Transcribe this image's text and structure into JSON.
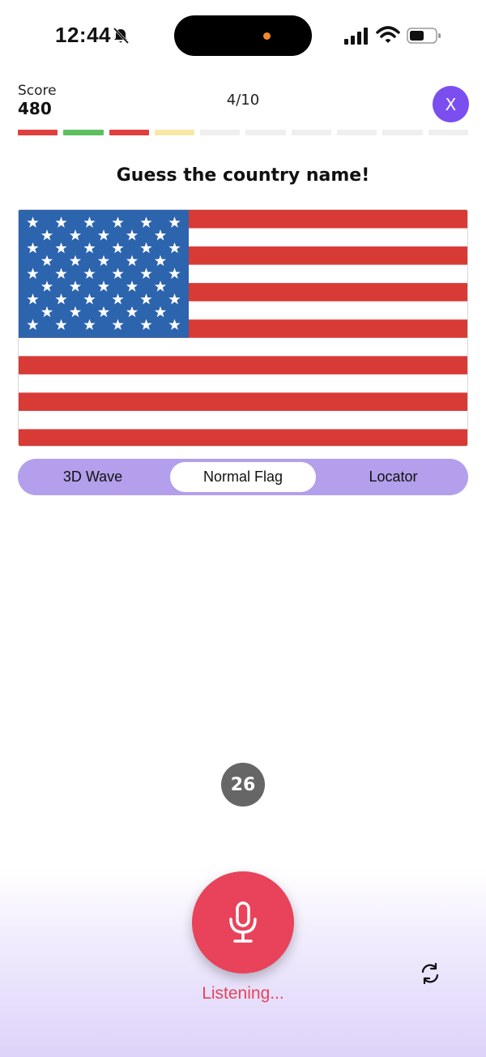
{
  "status_bar": {
    "time": "12:44",
    "icons": [
      "bell-slash-icon",
      "signal-icon",
      "wifi-icon",
      "battery-icon"
    ]
  },
  "header": {
    "score_label": "Score",
    "score_value": "480",
    "progress": "4/10",
    "close_label": "X"
  },
  "progress_segments": [
    {
      "state": "wrong",
      "color": "#e0403c"
    },
    {
      "state": "correct",
      "color": "#5cc061"
    },
    {
      "state": "wrong",
      "color": "#e0403c"
    },
    {
      "state": "current",
      "color": "#f7e8a6"
    },
    {
      "state": "pending",
      "color": "#efefef"
    },
    {
      "state": "pending",
      "color": "#efefef"
    },
    {
      "state": "pending",
      "color": "#efefef"
    },
    {
      "state": "pending",
      "color": "#efefef"
    },
    {
      "state": "pending",
      "color": "#efefef"
    },
    {
      "state": "pending",
      "color": "#efefef"
    }
  ],
  "question": {
    "title": "Guess the country name!"
  },
  "view_modes": {
    "options": [
      "3D Wave",
      "Normal Flag",
      "Locator"
    ],
    "selected": "Normal Flag"
  },
  "timer": {
    "value": "26"
  },
  "mic": {
    "status": "Listening..."
  },
  "colors": {
    "accent": "#7b4ef0",
    "segment_bg": "#b39feb",
    "mic": "#e8435b",
    "flag_red": "#d83a35",
    "flag_blue": "#2c64ae"
  }
}
